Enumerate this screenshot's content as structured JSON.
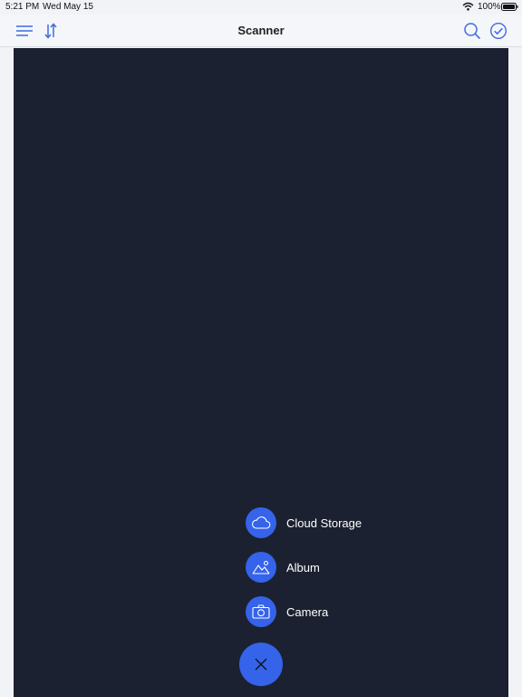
{
  "status_bar": {
    "time": "5:21 PM",
    "date": "Wed May 15",
    "battery": "100%",
    "wifi_icon": "wifi-icon",
    "battery_icon": "battery-icon"
  },
  "nav": {
    "title": "Scanner",
    "left_icons": [
      "menu-icon",
      "sort-icon"
    ],
    "right_icons": [
      "search-icon",
      "select-check-icon"
    ]
  },
  "fab_menu": {
    "items": [
      {
        "label": "Cloud Storage",
        "icon": "cloud-icon"
      },
      {
        "label": "Album",
        "icon": "album-icon"
      },
      {
        "label": "Camera",
        "icon": "camera-icon"
      }
    ],
    "close_icon": "close-icon"
  },
  "colors": {
    "accent": "#3563e9",
    "overlay": "#1b2130",
    "nav_icon": "#3f6ae3",
    "background": "#f1f3f7"
  }
}
